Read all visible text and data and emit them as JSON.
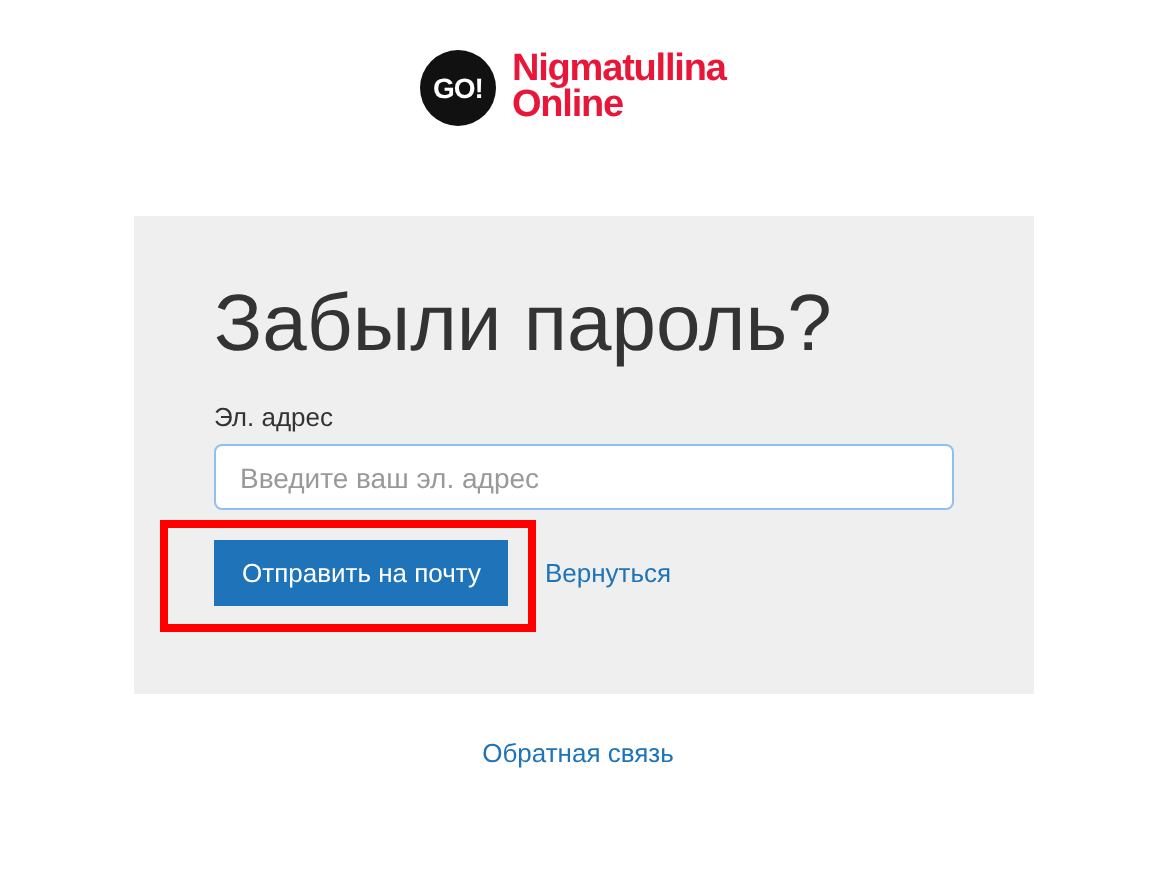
{
  "logo": {
    "badge": "GO!",
    "name_line_1": "Nigmatullina",
    "name_line_2": "Online"
  },
  "form": {
    "title": "Забыли пароль?",
    "email_label": "Эл. адрес",
    "email_placeholder": "Введите ваш эл. адрес",
    "submit": "Отправить на почту",
    "back_link": "Вернуться",
    "submit_highlighted": true
  },
  "footer_link": "Обратная связь"
}
